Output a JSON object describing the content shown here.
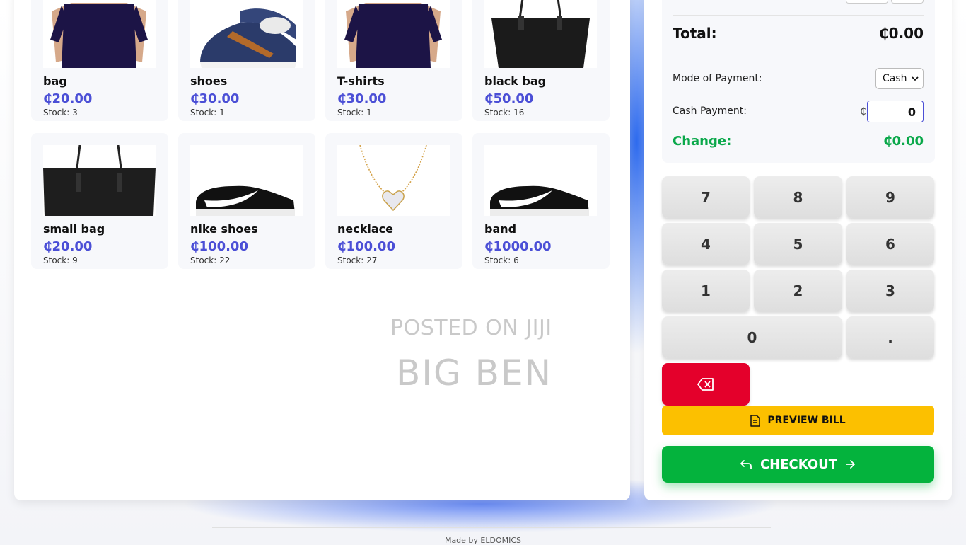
{
  "products": [
    {
      "name": "bag",
      "price": "₵20.00",
      "stock": "Stock: 3",
      "image": "navy-tshirt"
    },
    {
      "name": "shoes",
      "price": "₵30.00",
      "stock": "Stock: 1",
      "image": "navy-sneakers"
    },
    {
      "name": "T-shirts",
      "price": "₵30.00",
      "stock": "Stock: 1",
      "image": "navy-tshirt"
    },
    {
      "name": "black bag",
      "price": "₵50.00",
      "stock": "Stock: 16",
      "image": "black-tote-bag"
    },
    {
      "name": "small bag",
      "price": "₵20.00",
      "stock": "Stock: 9",
      "image": "black-tote-bag"
    },
    {
      "name": "nike shoes",
      "price": "₵100.00",
      "stock": "Stock: 22",
      "image": "black-nike-shoe"
    },
    {
      "name": "necklace",
      "price": "₵100.00",
      "stock": "Stock: 27",
      "image": "gold-heart-necklace"
    },
    {
      "name": "band",
      "price": "₵1000.00",
      "stock": "Stock: 6",
      "image": "black-nike-shoe"
    }
  ],
  "watermark": {
    "line1": "POSTED ON JIJI",
    "line2": "BIG BEN"
  },
  "summary": {
    "total_label": "Total:",
    "total_value": "₵0.00",
    "mode_label": "Mode of Payment:",
    "mode_value": "Cash",
    "cash_label": "Cash Payment:",
    "cash_symbol": "₵",
    "cash_value": "0",
    "change_label": "Change:",
    "change_value": "₵0.00"
  },
  "keypad": {
    "k7": "7",
    "k8": "8",
    "k9": "9",
    "k4": "4",
    "k5": "5",
    "k6": "6",
    "k1": "1",
    "k2": "2",
    "k3": "3",
    "k0": "0",
    "kdot": "."
  },
  "buttons": {
    "preview": "PREVIEW BILL",
    "checkout": "CHECKOUT"
  },
  "footer": "Made by ELDOMICS",
  "colors": {
    "accent": "#4b4fd6",
    "change": "#0aa84a",
    "checkout": "#04b33d",
    "preview": "#fcc000",
    "backspace": "#e4002b"
  }
}
